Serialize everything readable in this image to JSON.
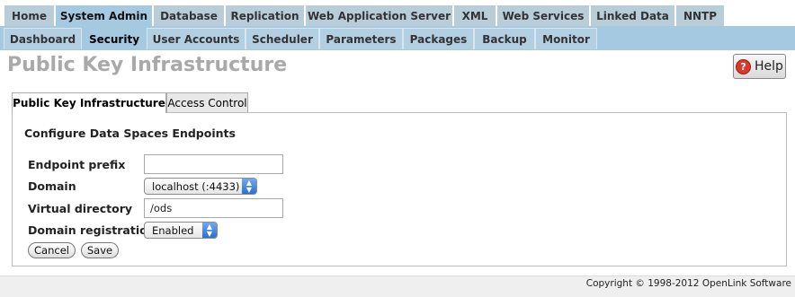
{
  "nav_primary": {
    "tabs": [
      {
        "label": "Home",
        "active": false
      },
      {
        "label": "System Admin",
        "active": true
      },
      {
        "label": "Database",
        "active": false
      },
      {
        "label": "Replication",
        "active": false
      },
      {
        "label": "Web Application Server",
        "active": false
      },
      {
        "label": "XML",
        "active": false
      },
      {
        "label": "Web Services",
        "active": false
      },
      {
        "label": "Linked Data",
        "active": false
      },
      {
        "label": "NNTP",
        "active": false
      }
    ]
  },
  "nav_secondary": {
    "tabs": [
      {
        "label": "Dashboard",
        "active": false
      },
      {
        "label": "Security",
        "active": true
      },
      {
        "label": "User Accounts",
        "active": false
      },
      {
        "label": "Scheduler",
        "active": false
      },
      {
        "label": "Parameters",
        "active": false
      },
      {
        "label": "Packages",
        "active": false
      },
      {
        "label": "Backup",
        "active": false
      },
      {
        "label": "Monitor",
        "active": false
      }
    ]
  },
  "page": {
    "title": "Public Key Infrastructure",
    "help_label": "Help",
    "help_icon": "question-mark-icon"
  },
  "content_tabs": [
    {
      "label": "Public Key Infrastructure",
      "active": true
    },
    {
      "label": "Access Control",
      "active": false
    }
  ],
  "form": {
    "section_title": "Configure Data Spaces Endpoints",
    "endpoint_prefix": {
      "label": "Endpoint prefix",
      "value": ""
    },
    "domain": {
      "label": "Domain",
      "value": "localhost (:4433)"
    },
    "virtual_directory": {
      "label": "Virtual directory",
      "value": "/ods"
    },
    "domain_registration": {
      "label": "Domain registration",
      "value": "Enabled"
    },
    "cancel_label": "Cancel",
    "save_label": "Save"
  },
  "footer": {
    "copyright": "Copyright © 1998-2012 OpenLink Software"
  },
  "colors": {
    "nav_active": "#a5c9e0",
    "nav_inactive": "#b9cdd9",
    "title_gray": "#a9a9a9",
    "help_red": "#d8392b",
    "select_blue": "#2b6fd6"
  }
}
